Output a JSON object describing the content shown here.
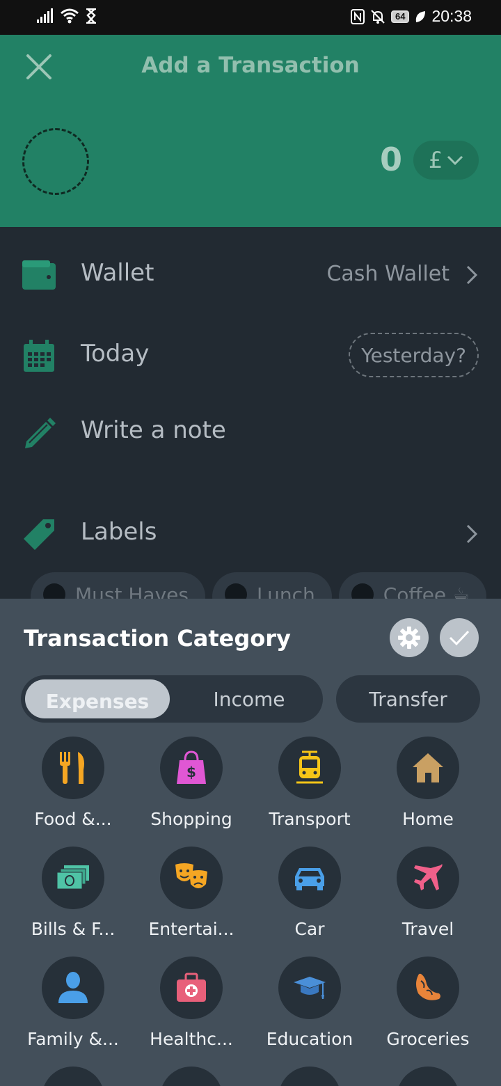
{
  "status_bar": {
    "time": "20:38",
    "battery": "64"
  },
  "header": {
    "title": "Add a Transaction",
    "amount": "0",
    "currency": "£"
  },
  "form": {
    "wallet": {
      "label": "Wallet",
      "value": "Cash Wallet"
    },
    "date": {
      "label": "Today",
      "quick_option": "Yesterday?"
    },
    "note": {
      "placeholder": "Write a note"
    },
    "labels": {
      "label": "Labels",
      "chips": [
        "Must Haves",
        "Lunch",
        "Coffee ☕"
      ]
    }
  },
  "category_sheet": {
    "title": "Transaction Category",
    "tabs": {
      "expenses": "Expenses",
      "income": "Income",
      "transfer": "Transfer"
    },
    "categories": [
      {
        "name": "Food &...",
        "icon": "food-icon",
        "color": "#f5a623"
      },
      {
        "name": "Shopping",
        "icon": "shopping-bag-icon",
        "color": "#e057d4"
      },
      {
        "name": "Transport",
        "icon": "tram-icon",
        "color": "#f5c518"
      },
      {
        "name": "Home",
        "icon": "home-icon",
        "color": "#c9a063"
      },
      {
        "name": "Bills & F...",
        "icon": "bills-icon",
        "color": "#4fc3a6"
      },
      {
        "name": "Entertai...",
        "icon": "theater-masks-icon",
        "color": "#f5a623"
      },
      {
        "name": "Car",
        "icon": "car-icon",
        "color": "#4a9fe8"
      },
      {
        "name": "Travel",
        "icon": "airplane-icon",
        "color": "#f0608a"
      },
      {
        "name": "Family &...",
        "icon": "person-icon",
        "color": "#4a9fe8"
      },
      {
        "name": "Healthc...",
        "icon": "medical-kit-icon",
        "color": "#e8607a"
      },
      {
        "name": "Education",
        "icon": "graduation-cap-icon",
        "color": "#4a8fd8"
      },
      {
        "name": "Groceries",
        "icon": "croissant-icon",
        "color": "#e8843a"
      }
    ]
  }
}
